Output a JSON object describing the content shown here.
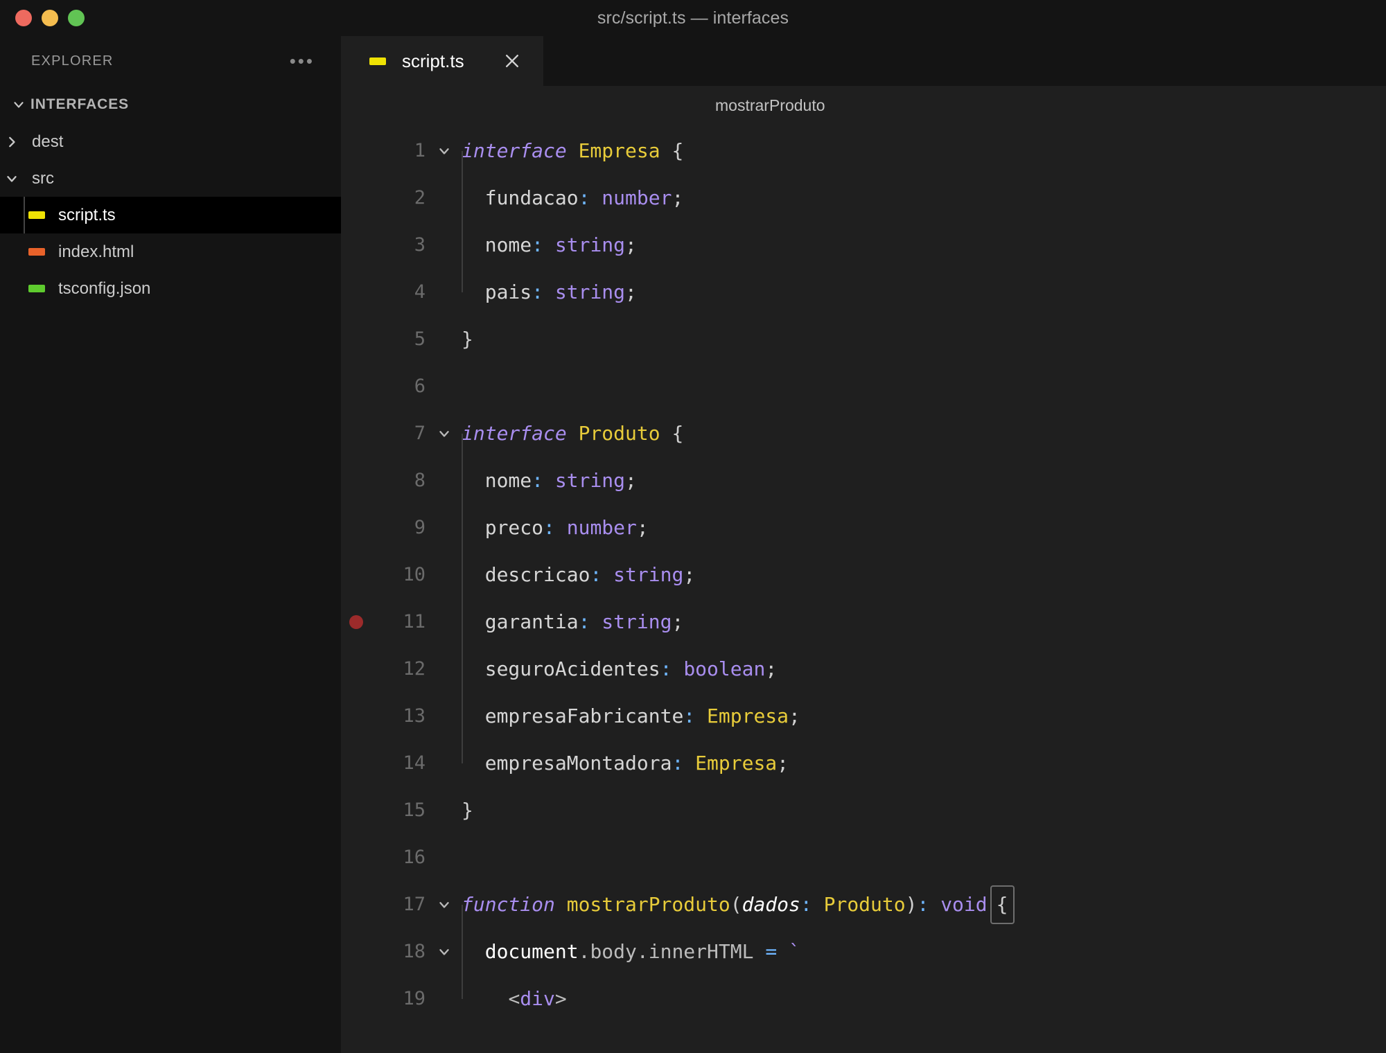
{
  "window": {
    "title": "src/script.ts — interfaces",
    "traffic_lights": [
      "close-red",
      "minimize-yellow",
      "maximize-green"
    ]
  },
  "sidebar": {
    "header_label": "EXPLORER",
    "more_actions_icon": "ellipsis-icon",
    "root": {
      "label": "INTERFACES",
      "expanded": true,
      "chevron": "chevron-down-icon"
    },
    "items": [
      {
        "label": "dest",
        "type": "folder",
        "expanded": false,
        "chevron": "chevron-right-icon",
        "depth": 1,
        "selected": false,
        "icon_color": ""
      },
      {
        "label": "src",
        "type": "folder",
        "expanded": true,
        "chevron": "chevron-down-icon",
        "depth": 1,
        "selected": false,
        "icon_color": ""
      },
      {
        "label": "script.ts",
        "type": "file",
        "depth": 2,
        "selected": true,
        "icon_color": "#efe204"
      },
      {
        "label": "index.html",
        "type": "file",
        "depth": 1,
        "selected": false,
        "icon_color": "#e8622a"
      },
      {
        "label": "tsconfig.json",
        "type": "file",
        "depth": 1,
        "selected": false,
        "icon_color": "#5ecb2e"
      }
    ]
  },
  "editor": {
    "tab": {
      "label": "script.ts",
      "icon_color": "#efe204",
      "close_icon": "close-icon",
      "active": true
    },
    "breadcrumb": "mostrarProduto",
    "file_language": "typescript",
    "breakpoint_line": 11,
    "lines": [
      {
        "n": "1",
        "fold": "chevron-down-icon",
        "indent": 0,
        "tokens": [
          {
            "t": "interface",
            "c": "kw"
          },
          {
            "t": " ",
            "c": "punc"
          },
          {
            "t": "Empresa",
            "c": "typ"
          },
          {
            "t": " ",
            "c": "punc"
          },
          {
            "t": "{",
            "c": "punc"
          }
        ]
      },
      {
        "n": "2",
        "fold": "",
        "indent": 1,
        "tokens": [
          {
            "t": "fundacao",
            "c": "prop"
          },
          {
            "t": ":",
            "c": "colon"
          },
          {
            "t": " ",
            "c": "punc"
          },
          {
            "t": "number",
            "c": "tvar"
          },
          {
            "t": ";",
            "c": "punc"
          }
        ]
      },
      {
        "n": "3",
        "fold": "",
        "indent": 1,
        "tokens": [
          {
            "t": "nome",
            "c": "prop"
          },
          {
            "t": ":",
            "c": "colon"
          },
          {
            "t": " ",
            "c": "punc"
          },
          {
            "t": "string",
            "c": "tvar"
          },
          {
            "t": ";",
            "c": "punc"
          }
        ]
      },
      {
        "n": "4",
        "fold": "",
        "indent": 1,
        "tokens": [
          {
            "t": "pais",
            "c": "prop"
          },
          {
            "t": ":",
            "c": "colon"
          },
          {
            "t": " ",
            "c": "punc"
          },
          {
            "t": "string",
            "c": "tvar"
          },
          {
            "t": ";",
            "c": "punc"
          }
        ]
      },
      {
        "n": "5",
        "fold": "",
        "indent": 0,
        "tokens": [
          {
            "t": "}",
            "c": "punc"
          }
        ]
      },
      {
        "n": "6",
        "fold": "",
        "indent": 0,
        "tokens": []
      },
      {
        "n": "7",
        "fold": "chevron-down-icon",
        "indent": 0,
        "tokens": [
          {
            "t": "interface",
            "c": "kw"
          },
          {
            "t": " ",
            "c": "punc"
          },
          {
            "t": "Produto",
            "c": "typ"
          },
          {
            "t": " ",
            "c": "punc"
          },
          {
            "t": "{",
            "c": "punc"
          }
        ]
      },
      {
        "n": "8",
        "fold": "",
        "indent": 1,
        "tokens": [
          {
            "t": "nome",
            "c": "prop"
          },
          {
            "t": ":",
            "c": "colon"
          },
          {
            "t": " ",
            "c": "punc"
          },
          {
            "t": "string",
            "c": "tvar"
          },
          {
            "t": ";",
            "c": "punc"
          }
        ]
      },
      {
        "n": "9",
        "fold": "",
        "indent": 1,
        "tokens": [
          {
            "t": "preco",
            "c": "prop"
          },
          {
            "t": ":",
            "c": "colon"
          },
          {
            "t": " ",
            "c": "punc"
          },
          {
            "t": "number",
            "c": "tvar"
          },
          {
            "t": ";",
            "c": "punc"
          }
        ]
      },
      {
        "n": "10",
        "fold": "",
        "indent": 1,
        "tokens": [
          {
            "t": "descricao",
            "c": "prop"
          },
          {
            "t": ":",
            "c": "colon"
          },
          {
            "t": " ",
            "c": "punc"
          },
          {
            "t": "string",
            "c": "tvar"
          },
          {
            "t": ";",
            "c": "punc"
          }
        ]
      },
      {
        "n": "11",
        "fold": "",
        "indent": 1,
        "breakpoint": true,
        "tokens": [
          {
            "t": "garantia",
            "c": "prop"
          },
          {
            "t": ":",
            "c": "colon"
          },
          {
            "t": " ",
            "c": "punc"
          },
          {
            "t": "string",
            "c": "tvar"
          },
          {
            "t": ";",
            "c": "punc"
          }
        ]
      },
      {
        "n": "12",
        "fold": "",
        "indent": 1,
        "tokens": [
          {
            "t": "seguroAcidentes",
            "c": "prop"
          },
          {
            "t": ":",
            "c": "colon"
          },
          {
            "t": " ",
            "c": "punc"
          },
          {
            "t": "boolean",
            "c": "tvar"
          },
          {
            "t": ";",
            "c": "punc"
          }
        ]
      },
      {
        "n": "13",
        "fold": "",
        "indent": 1,
        "tokens": [
          {
            "t": "empresaFabricante",
            "c": "prop"
          },
          {
            "t": ":",
            "c": "colon"
          },
          {
            "t": " ",
            "c": "punc"
          },
          {
            "t": "Empresa",
            "c": "typ"
          },
          {
            "t": ";",
            "c": "punc"
          }
        ]
      },
      {
        "n": "14",
        "fold": "",
        "indent": 1,
        "tokens": [
          {
            "t": "empresaMontadora",
            "c": "prop"
          },
          {
            "t": ":",
            "c": "colon"
          },
          {
            "t": " ",
            "c": "punc"
          },
          {
            "t": "Empresa",
            "c": "typ"
          },
          {
            "t": ";",
            "c": "punc"
          }
        ]
      },
      {
        "n": "15",
        "fold": "",
        "indent": 0,
        "tokens": [
          {
            "t": "}",
            "c": "punc"
          }
        ]
      },
      {
        "n": "16",
        "fold": "",
        "indent": 0,
        "tokens": []
      },
      {
        "n": "17",
        "fold": "chevron-down-icon",
        "indent": 0,
        "tokens": [
          {
            "t": "function",
            "c": "kw"
          },
          {
            "t": " ",
            "c": "punc"
          },
          {
            "t": "mostrarProduto",
            "c": "typ"
          },
          {
            "t": "(",
            "c": "punc"
          },
          {
            "t": "dados",
            "c": "plain italic"
          },
          {
            "t": ":",
            "c": "colon"
          },
          {
            "t": " ",
            "c": "punc"
          },
          {
            "t": "Produto",
            "c": "typ"
          },
          {
            "t": ")",
            "c": "punc"
          },
          {
            "t": ":",
            "c": "colon"
          },
          {
            "t": " ",
            "c": "punc"
          },
          {
            "t": "void",
            "c": "tvar"
          },
          {
            "t": "{",
            "c": "punc brkbox"
          }
        ]
      },
      {
        "n": "18",
        "fold": "chevron-down-icon",
        "indent": 1,
        "tokens": [
          {
            "t": "document",
            "c": "plain"
          },
          {
            "t": ".",
            "c": "dim"
          },
          {
            "t": "body",
            "c": "dim"
          },
          {
            "t": ".",
            "c": "dim"
          },
          {
            "t": "innerHTML",
            "c": "dim"
          },
          {
            "t": " ",
            "c": "punc"
          },
          {
            "t": "=",
            "c": "op"
          },
          {
            "t": " ",
            "c": "punc"
          },
          {
            "t": "`",
            "c": "tvar"
          }
        ]
      },
      {
        "n": "19",
        "fold": "",
        "indent": 2,
        "tokens": [
          {
            "t": "<",
            "c": "dim"
          },
          {
            "t": "div",
            "c": "tvar"
          },
          {
            "t": ">",
            "c": "dim"
          }
        ]
      }
    ]
  }
}
